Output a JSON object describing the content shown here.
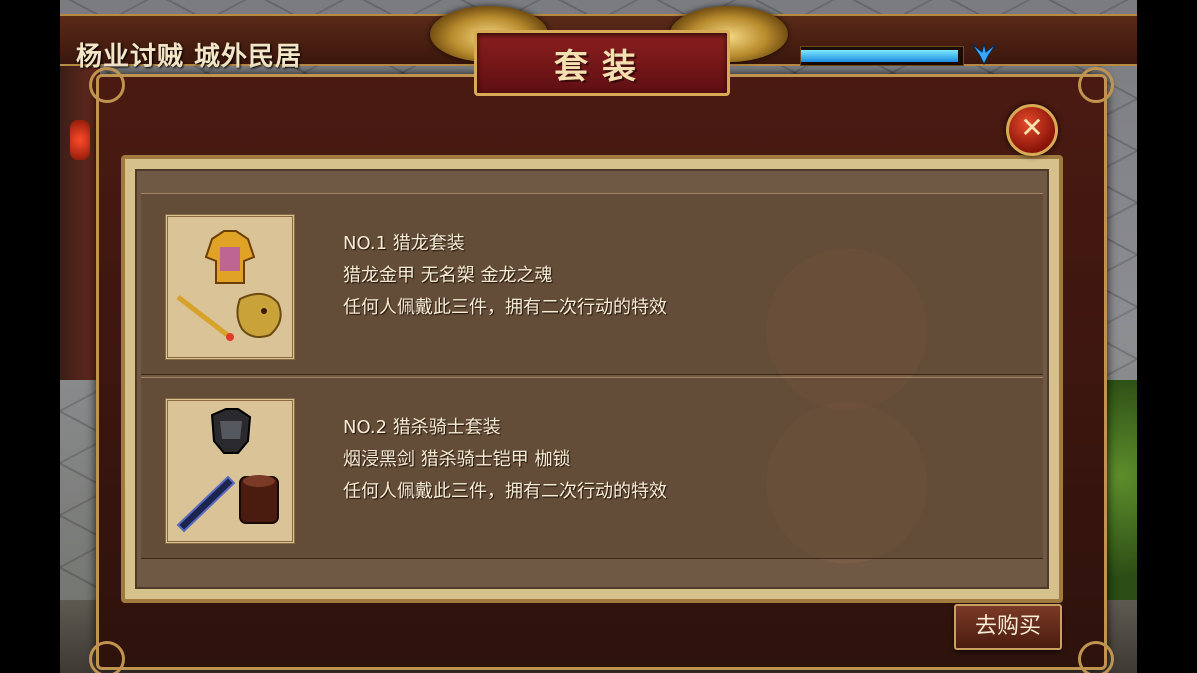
{
  "location": "杨业讨贼 城外民居",
  "hp_bar": {
    "fill_fraction": 0.97,
    "icon": "blue-bird-icon"
  },
  "title": "套装",
  "close_icon": "close-icon",
  "sets": [
    {
      "label": "NO.1 猎龙套装",
      "items": "猎龙金甲 无名槊 金龙之魂",
      "effect": "任何人佩戴此三件，拥有二次行动的特效"
    },
    {
      "label": "NO.2 猎杀骑士套装",
      "items": "烟浸黑剑 猎杀骑士铠甲 枷锁",
      "effect": "任何人佩戴此三件，拥有二次行动的特效"
    }
  ],
  "buy_button": "去购买",
  "colors": {
    "accent_gold": "#c09450",
    "panel_red": "#5f0f12",
    "hp_blue": "#1a8de0"
  }
}
